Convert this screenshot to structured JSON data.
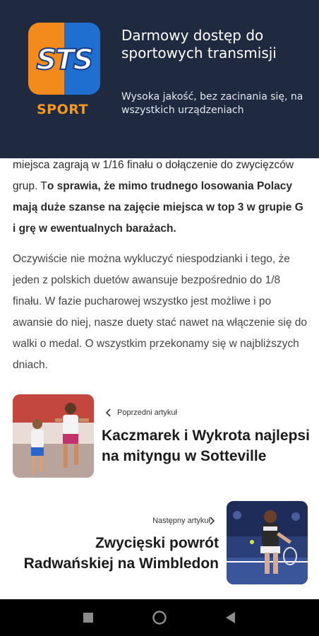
{
  "banner": {
    "logo_text": "STS",
    "logo_sport": "SPORT",
    "title": "Darmowy dostęp do sportowych transmisji",
    "subtitle": "Wysoka jakość, bez zacinania się, na wszystkich urządzeniach",
    "colors": {
      "background": "#1f2a41",
      "orange": "#f28a1c",
      "blue": "#1e6fd0"
    }
  },
  "article": {
    "para1_normal": "miejsca zagrają w 1/16 finału o dołączenie do zwycięzców grup. T",
    "para1_bold": "o sprawia, że mimo trudnego losowania Polacy mają duże szanse na zajęcie miejsca w top 3 w grupie G i grę w ewentualnych barażach.",
    "para2": "Oczywiście nie można wykluczyć niespodzianki i tego, że jeden z polskich duetów awansuje bezpośrednio do 1/8 finału. W fazie pucharowej wszystko jest możliwe i po awansie do niej, nasze duety stać nawet na włączenie się do walki o medal. O wszystkim przekonamy się w najbliższych dniach."
  },
  "prev_article": {
    "label": "Poprzedni artykuł",
    "title": "Kaczmarek i Wykrota najlepsi na mityngu w Sotteville",
    "icon": "chevron-left-icon"
  },
  "next_article": {
    "label": "Następny artykuł",
    "title": "Zwycięski powrót Radwańskiej na Wimbledon",
    "icon": "chevron-right-icon"
  },
  "navbar": {
    "icons": [
      "square-recents-icon",
      "circle-home-icon",
      "triangle-back-icon"
    ]
  }
}
